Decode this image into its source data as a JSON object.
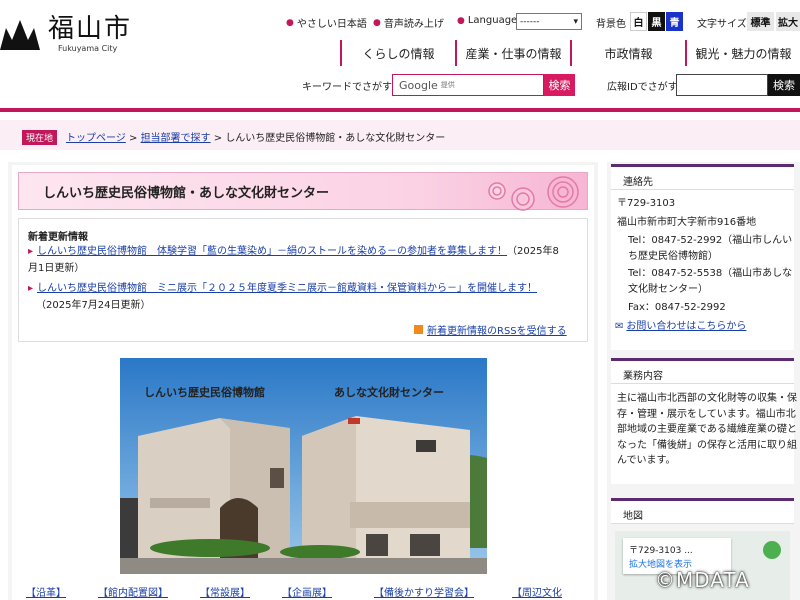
{
  "header": {
    "site_name": "福山市",
    "site_sub": "Fukuyama City",
    "util": {
      "easy_japanese": "やさしい日本語",
      "voice": "音声読み上げ",
      "language": "Language",
      "language_selected": "------",
      "bg_label": "背景色",
      "bg_white": "白",
      "bg_black": "黒",
      "bg_blue": "青",
      "font_label": "文字サイズ",
      "font_standard": "標準",
      "font_large": "拡大"
    },
    "nav": [
      "くらしの情報",
      "産業・仕事の情報",
      "市政情報",
      "観光・魅力の情報"
    ],
    "search": {
      "label": "キーワードでさがす",
      "google": "Google",
      "provided": "提供",
      "button": "検索"
    },
    "page_id": {
      "label": "広報IDでさがす",
      "button": "検索"
    }
  },
  "breadcrumb": {
    "tag": "現在地",
    "top": "トップページ",
    "sep1": " > ",
    "dept": "担当部署で探す",
    "sep2": " > ",
    "current": "しんいち歴史民俗博物館・あしな文化財センター"
  },
  "main": {
    "title": "しんいち歴史民俗博物館・あしな文化財センター",
    "news_heading": "新着更新情報",
    "news": [
      {
        "link": "しんいち歴史民俗博物館　体験学習「藍の生葉染め」－絹のストールを染める－の参加者を募集します！",
        "date_line1": "（2025年8",
        "date_line2": "月1日更新）"
      },
      {
        "link": "しんいち歴史民俗博物館　ミニ展示「２０２５年度夏季ミニ展示－館蔵資料・保管資料から－」を開催します！",
        "date": "（2025年7月24日更新）"
      }
    ],
    "rss": "新着更新情報のRSSを受信する",
    "photo_caption_left": "しんいち歴史民俗博物館",
    "photo_caption_right": "あしな文化財センター",
    "links": [
      "【沿革】",
      "【館内配置図】",
      "【常設展】",
      "【企画展】",
      "【備後かすり学習会】",
      "【周辺文化"
    ]
  },
  "sidebar": {
    "contact_heading": "連絡先",
    "postal": "〒729-3103",
    "address": "福山市新市町大字新市916番地",
    "tel1_a": "Tel：0847-52-2992（福山市しんい",
    "tel1_b": "ち歴史民俗博物館）",
    "tel2_a": "Tel：0847-52-5538（福山市あしな",
    "tel2_b": "文化財センター）",
    "fax": "Fax：0847-52-2992",
    "inquiry": "お問い合わせはこちらから",
    "business_heading": "業務内容",
    "business_lines": [
      "主に福山市北西部の文化財等の収集・保",
      "存・管理・展示をしています。福山市北",
      "部地域の主要産業である繊維産業の礎と",
      "なった「備後絣」の保存と活用に取り組",
      "んでいます。"
    ],
    "map_heading": "地図",
    "map_postal": "〒729-3103 ...",
    "map_link": "拡大地図を表示"
  },
  "watermark": "©MDATA",
  "colors": {
    "accent": "#c2185b",
    "sidebar_rule": "#5c2a6e"
  }
}
